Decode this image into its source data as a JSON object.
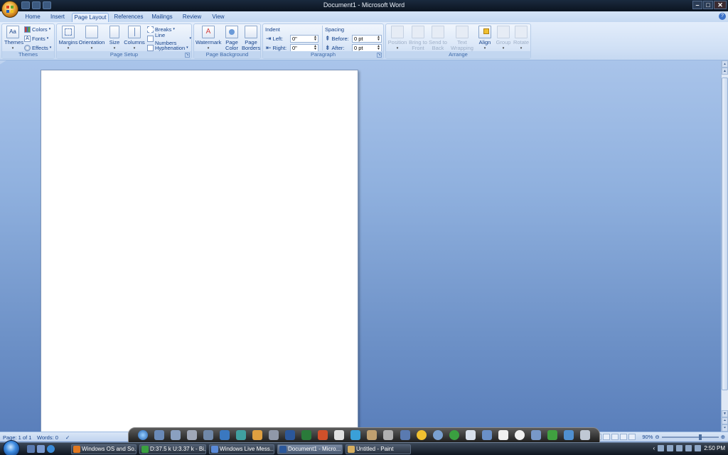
{
  "window": {
    "title": "Document1 - Microsoft Word",
    "controls": [
      "minimize",
      "maximize",
      "close"
    ]
  },
  "tabs": [
    {
      "label": "Home",
      "active": false
    },
    {
      "label": "Insert",
      "active": false
    },
    {
      "label": "Page Layout",
      "active": true
    },
    {
      "label": "References",
      "active": false
    },
    {
      "label": "Mailings",
      "active": false
    },
    {
      "label": "Review",
      "active": false
    },
    {
      "label": "View",
      "active": false
    }
  ],
  "ribbon": {
    "themes": {
      "group_label": "Themes",
      "themes_button": "Themes",
      "colors": "Colors",
      "fonts": "Fonts",
      "effects": "Effects"
    },
    "page_setup": {
      "group_label": "Page Setup",
      "margins": "Margins",
      "orientation": "Orientation",
      "size": "Size",
      "columns": "Columns",
      "breaks": "Breaks",
      "line_numbers": "Line Numbers",
      "hyphenation": "Hyphenation"
    },
    "page_background": {
      "group_label": "Page Background",
      "watermark": "Watermark",
      "page_color_1": "Page",
      "page_color_2": "Color",
      "page_borders_1": "Page",
      "page_borders_2": "Borders"
    },
    "paragraph": {
      "group_label": "Paragraph",
      "indent_heading": "Indent",
      "left_label": "Left:",
      "left_value": "0\"",
      "right_label": "Right:",
      "right_value": "0\"",
      "spacing_heading": "Spacing",
      "before_label": "Before:",
      "before_value": "0 pt",
      "after_label": "After:",
      "after_value": "0 pt"
    },
    "arrange": {
      "group_label": "Arrange",
      "position": "Position",
      "bring_front_1": "Bring to",
      "bring_front_2": "Front",
      "send_back_1": "Send to",
      "send_back_2": "Back",
      "text_wrap_1": "Text",
      "text_wrap_2": "Wrapping",
      "align": "Align",
      "group": "Group",
      "rotate": "Rotate"
    }
  },
  "status": {
    "page": "Page: 1 of 1",
    "words": "Words: 0",
    "zoom": "90%"
  },
  "taskbar": {
    "buttons": [
      {
        "label": "Windows OS and So...",
        "color": "#e07820"
      },
      {
        "label": "D:37.5 k U:3.37 k - Bi...",
        "color": "#3aa040"
      },
      {
        "label": "Windows Live Mess...",
        "color": "#5a8ad8"
      },
      {
        "label": "Document1 - Micro...",
        "color": "#2b579a"
      },
      {
        "label": "Untitled - Paint",
        "color": "#d8b060"
      }
    ],
    "clock": "2:50 PM"
  },
  "colors": {
    "ribbon_text": "#15428b",
    "workspace_top": "#a9c4ea",
    "workspace_bottom": "#5a7fbb"
  }
}
